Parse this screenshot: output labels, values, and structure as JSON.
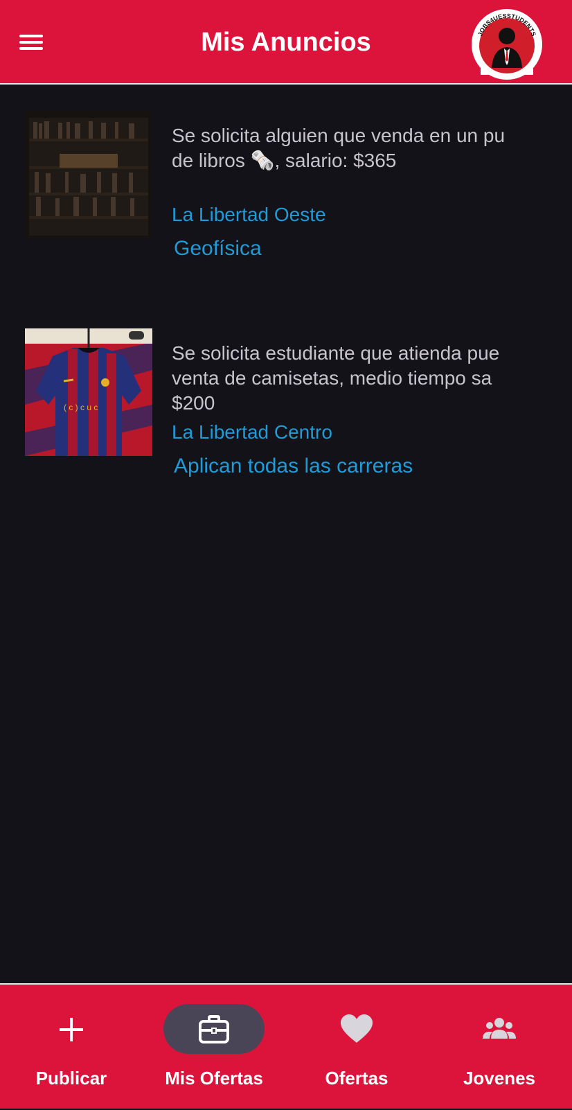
{
  "appbar": {
    "title": "Mis Anuncios",
    "menu_icon": "hamburger-menu-icon",
    "logo_text": "JOBS4UESSTUDENTS",
    "brand_color": "#dc143c"
  },
  "ads": [
    {
      "image": "bookshelf-photo",
      "description": "Se solicita alguien que venda en un pu\nde libros 🗞️, salario: $365",
      "location": "La Libertad Oeste",
      "career": "Geofísica"
    },
    {
      "image": "soccer-jersey-photo",
      "description": "Se solicita estudiante que atienda pue\nventa de camisetas, medio tiempo sa\n$200",
      "location": "La Libertad Centro",
      "career": "Aplican todas las carreras"
    }
  ],
  "bottom_nav": {
    "items": [
      {
        "label": "Publicar",
        "icon": "plus-icon",
        "active": false
      },
      {
        "label": "Mis Ofertas",
        "icon": "briefcase-icon",
        "active": true
      },
      {
        "label": "Ofertas",
        "icon": "heart-icon",
        "active": false
      },
      {
        "label": "Jovenes",
        "icon": "group-icon",
        "active": false
      }
    ]
  },
  "colors": {
    "background": "#131218",
    "link": "#1f9bd8",
    "text": "#c7c4cc",
    "active_pill": "#4a4556"
  }
}
